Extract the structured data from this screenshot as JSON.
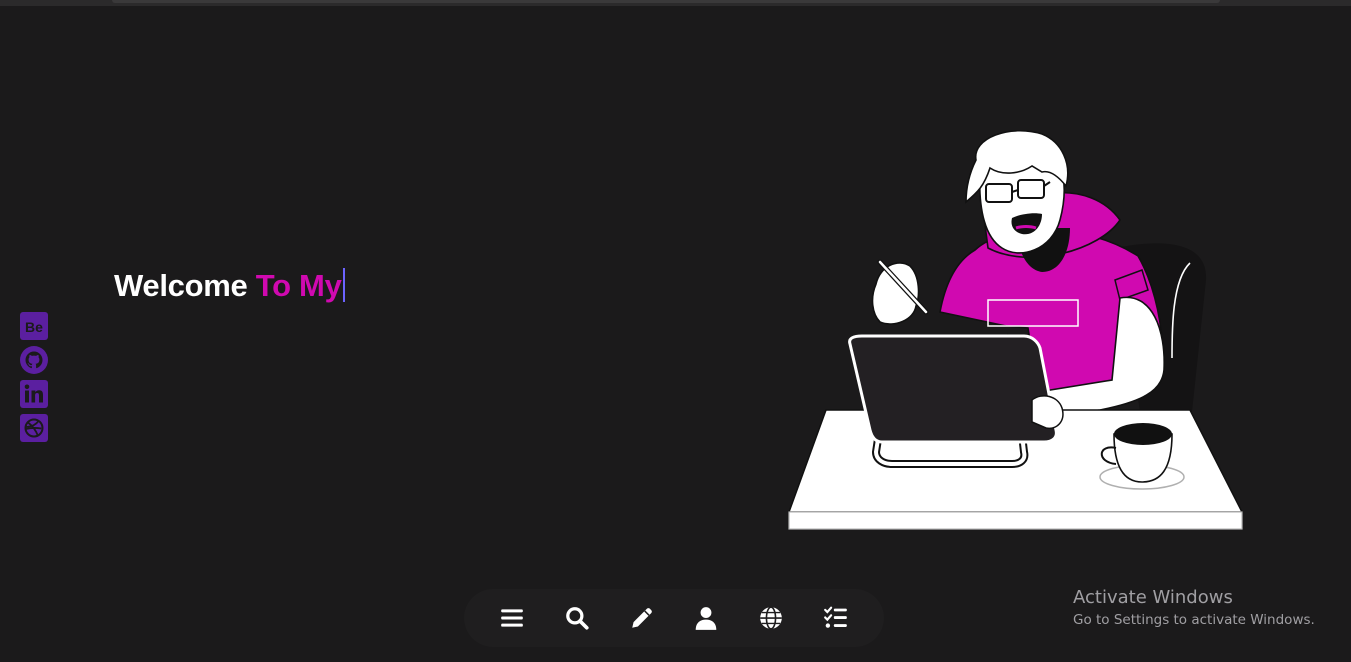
{
  "hero": {
    "title_plain": "Welcome",
    "title_accent": "To My",
    "accent_color": "#d009b0",
    "caret_color": "#6c63ff"
  },
  "social_links": [
    {
      "name": "behance",
      "icon": "behance-icon",
      "label": "Be"
    },
    {
      "name": "github",
      "icon": "github-icon"
    },
    {
      "name": "linkedin",
      "icon": "linkedin-icon",
      "label": "in"
    },
    {
      "name": "dribbble",
      "icon": "dribbble-icon"
    }
  ],
  "social_color": "#5b1fa0",
  "dock": {
    "items": [
      {
        "name": "menu",
        "icon": "menu-icon"
      },
      {
        "name": "search",
        "icon": "search-icon"
      },
      {
        "name": "edit",
        "icon": "pencil-icon"
      },
      {
        "name": "profile",
        "icon": "user-icon"
      },
      {
        "name": "web",
        "icon": "globe-icon"
      },
      {
        "name": "tasks",
        "icon": "checklist-icon"
      }
    ]
  },
  "illustration": {
    "subject": "developer-at-desk-illustration",
    "shirt_color": "#d009b0"
  },
  "watermark": {
    "title": "Activate Windows",
    "subtitle": "Go to Settings to activate Windows."
  }
}
